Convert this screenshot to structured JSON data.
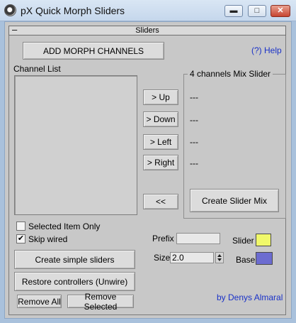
{
  "window": {
    "title": "pX Quick Morph Sliders",
    "minimize_label": "▬",
    "maximize_label": "□",
    "close_label": "✕"
  },
  "rollout": {
    "toggle": "–",
    "title": "Sliders"
  },
  "buttons": {
    "add_morph_channels": "ADD MORPH CHANNELS",
    "help": "(?) Help",
    "up": "> Up",
    "down": "> Down",
    "left": "> Left",
    "right": "> Right",
    "back": "<<",
    "create_slider_mix": "Create Slider Mix",
    "create_simple_sliders": "Create simple sliders",
    "restore_controllers": "Restore controllers (Unwire)",
    "remove_all": "Remove All",
    "remove_selected": "Remove Selected"
  },
  "channel_list": {
    "label": "Channel List",
    "items": []
  },
  "mix_slider": {
    "label": "4 channels Mix Slider",
    "slots": [
      "---",
      "---",
      "---",
      "---"
    ]
  },
  "options": {
    "selected_item_only": {
      "label": "Selected Item Only",
      "checked": false,
      "mark": ""
    },
    "skip_wired": {
      "label": "Skip wired",
      "checked": true,
      "mark": "✔"
    }
  },
  "prefix": {
    "label": "Prefix",
    "value": ""
  },
  "size": {
    "label": "Size",
    "value": "2.0"
  },
  "colors": {
    "slider": {
      "label": "Slider",
      "hex": "#f0f86a"
    },
    "base": {
      "label": "Base",
      "hex": "#6c6cd0"
    }
  },
  "credit": "by Denys Almaral"
}
